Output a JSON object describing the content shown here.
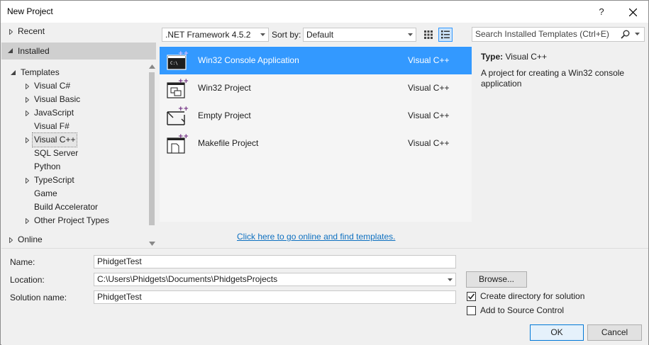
{
  "window": {
    "title": "New Project",
    "help": "?"
  },
  "tree": {
    "recent": "Recent",
    "installed": "Installed",
    "templates": "Templates",
    "items": [
      "Visual C#",
      "Visual Basic",
      "JavaScript",
      "Visual F#",
      "Visual C++",
      "SQL Server",
      "Python",
      "TypeScript",
      "Game",
      "Build Accelerator",
      "Other Project Types"
    ],
    "online": "Online"
  },
  "toolbar": {
    "framework": ".NET Framework 4.5.2",
    "sort_label": "Sort by:",
    "sort_value": "Default",
    "search_placeholder": "Search Installed Templates (Ctrl+E)"
  },
  "templates": [
    {
      "name": "Win32 Console Application",
      "lang": "Visual C++"
    },
    {
      "name": "Win32 Project",
      "lang": "Visual C++"
    },
    {
      "name": "Empty Project",
      "lang": "Visual C++"
    },
    {
      "name": "Makefile Project",
      "lang": "Visual C++"
    }
  ],
  "online_link": "Click here to go online and find templates.",
  "details": {
    "type_label": "Type:",
    "type_value": "Visual C++",
    "description": "A project for creating a Win32 console application"
  },
  "form": {
    "name_label": "Name:",
    "name_value": "PhidgetTest",
    "location_label": "Location:",
    "location_value": "C:\\Users\\Phidgets\\Documents\\PhidgetsProjects",
    "solution_label": "Solution name:",
    "solution_value": "PhidgetTest",
    "browse": "Browse...",
    "create_dir": "Create directory for solution",
    "source_control": "Add to Source Control",
    "ok": "OK",
    "cancel": "Cancel"
  },
  "colors": {
    "accent": "#3399ff",
    "link": "#0e70c0"
  }
}
